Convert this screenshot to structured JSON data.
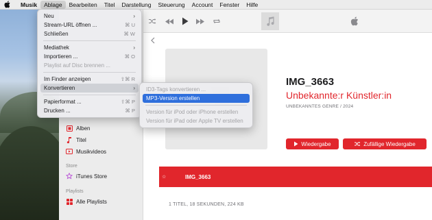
{
  "menubar": {
    "app_name": "Musik",
    "items": [
      "Ablage",
      "Bearbeiten",
      "Titel",
      "Darstellung",
      "Steuerung",
      "Account",
      "Fenster",
      "Hilfe"
    ]
  },
  "file_menu": {
    "items": [
      {
        "label": "Neu",
        "shortcut": "",
        "submenu": true,
        "disabled": false
      },
      {
        "label": "Stream-URL öffnen ...",
        "shortcut": "⌘ U",
        "submenu": false,
        "disabled": false
      },
      {
        "label": "Schließen",
        "shortcut": "⌘ W",
        "submenu": false,
        "disabled": false
      },
      {
        "label": "Mediathek",
        "shortcut": "",
        "submenu": true,
        "disabled": false
      },
      {
        "label": "Importieren ...",
        "shortcut": "⌘ O",
        "submenu": false,
        "disabled": false
      },
      {
        "label": "Playlist auf Disc brennen ...",
        "shortcut": "",
        "submenu": false,
        "disabled": true
      },
      {
        "label": "Im Finder anzeigen",
        "shortcut": "⇧⌘ R",
        "submenu": false,
        "disabled": false
      },
      {
        "label": "Konvertieren",
        "shortcut": "",
        "submenu": true,
        "disabled": false
      },
      {
        "label": "Papierformat ...",
        "shortcut": "⇧⌘ P",
        "submenu": false,
        "disabled": false
      },
      {
        "label": "Drucken ...",
        "shortcut": "⌘ P",
        "submenu": false,
        "disabled": false
      }
    ]
  },
  "convert_menu": {
    "items": [
      {
        "label": "ID3-Tags konvertieren ...",
        "disabled": true
      },
      {
        "label": "MP3-Version erstellen",
        "disabled": false
      },
      {
        "label": "Version für iPod oder iPhone erstellen",
        "disabled": true
      },
      {
        "label": "Version für iPad oder Apple TV erstellen",
        "disabled": true
      }
    ]
  },
  "sidebar": {
    "library_items": [
      {
        "label": "Alben",
        "icon": "album-icon"
      },
      {
        "label": "Titel",
        "icon": "note-icon"
      },
      {
        "label": "Musikvideos",
        "icon": "video-icon"
      }
    ],
    "store_section": "Store",
    "store_item": "iTunes Store",
    "playlists_section": "Playlists",
    "playlists_item": "Alle Playlists"
  },
  "album": {
    "title": "IMG_3663",
    "artist": "Unbekannte:r Künstler:in",
    "meta": "UNBEKANNTES GENRE / 2024",
    "play_label": "Wiedergabe",
    "shuffle_label": "Zufällige Wiedergabe"
  },
  "tracks": [
    {
      "star": "☆",
      "name": "IMG_3663"
    }
  ],
  "summary": "1 TITEL, 18 SEKUNDEN, 224 KB",
  "colors": {
    "accent": "#e1262c",
    "menu_highlight": "#2f6fdc"
  }
}
